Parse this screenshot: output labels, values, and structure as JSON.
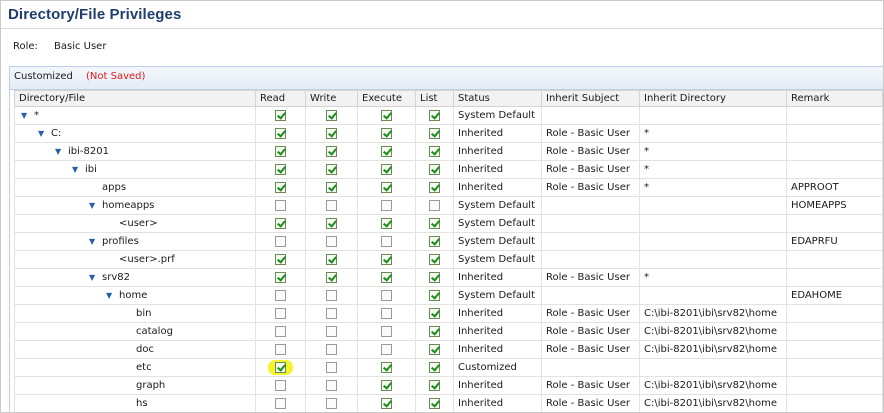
{
  "header": {
    "title": "Directory/File Privileges"
  },
  "role": {
    "label": "Role:",
    "value": "Basic User"
  },
  "panel": {
    "title": "Customized",
    "status": "(Not Saved)"
  },
  "table": {
    "columns": [
      "Directory/File",
      "Read",
      "Write",
      "Execute",
      "List",
      "Status",
      "Inherit Subject",
      "Inherit Directory",
      "Remark"
    ],
    "rows": [
      {
        "name": "*",
        "level": 0,
        "toggle": "expanded",
        "read": true,
        "write": true,
        "execute": true,
        "list": true,
        "status": "System Default",
        "subject": "",
        "directory": "",
        "remark": ""
      },
      {
        "name": "C:",
        "level": 1,
        "toggle": "expanded",
        "read": true,
        "write": true,
        "execute": true,
        "list": true,
        "status": "Inherited",
        "subject": "Role - Basic User",
        "directory": "*",
        "remark": ""
      },
      {
        "name": "ibi-8201",
        "level": 2,
        "toggle": "expanded",
        "read": true,
        "write": true,
        "execute": true,
        "list": true,
        "status": "Inherited",
        "subject": "Role - Basic User",
        "directory": "*",
        "remark": ""
      },
      {
        "name": "ibi",
        "level": 3,
        "toggle": "expanded",
        "read": true,
        "write": true,
        "execute": true,
        "list": true,
        "status": "Inherited",
        "subject": "Role - Basic User",
        "directory": "*",
        "remark": ""
      },
      {
        "name": "apps",
        "level": 4,
        "toggle": "none",
        "read": true,
        "write": true,
        "execute": true,
        "list": true,
        "status": "Inherited",
        "subject": "Role - Basic User",
        "directory": "*",
        "remark": "APPROOT"
      },
      {
        "name": "homeapps",
        "level": 4,
        "toggle": "expanded",
        "read": false,
        "write": false,
        "execute": false,
        "list": false,
        "status": "System Default",
        "subject": "",
        "directory": "",
        "remark": "HOMEAPPS"
      },
      {
        "name": "<user>",
        "level": 5,
        "toggle": "none",
        "read": true,
        "write": true,
        "execute": true,
        "list": true,
        "status": "System Default",
        "subject": "",
        "directory": "",
        "remark": ""
      },
      {
        "name": "profiles",
        "level": 4,
        "toggle": "expanded",
        "read": false,
        "write": false,
        "execute": false,
        "list": true,
        "status": "System Default",
        "subject": "",
        "directory": "",
        "remark": "EDAPRFU"
      },
      {
        "name": "<user>.prf",
        "level": 5,
        "toggle": "none",
        "read": true,
        "write": true,
        "execute": true,
        "list": true,
        "status": "System Default",
        "subject": "",
        "directory": "",
        "remark": ""
      },
      {
        "name": "srv82",
        "level": 4,
        "toggle": "expanded",
        "read": true,
        "write": true,
        "execute": true,
        "list": true,
        "status": "Inherited",
        "subject": "Role - Basic User",
        "directory": "*",
        "remark": ""
      },
      {
        "name": "home",
        "level": 5,
        "toggle": "expanded",
        "read": false,
        "write": false,
        "execute": false,
        "list": true,
        "status": "System Default",
        "subject": "",
        "directory": "",
        "remark": "EDAHOME"
      },
      {
        "name": "bin",
        "level": 6,
        "toggle": "none",
        "read": false,
        "write": false,
        "execute": false,
        "list": true,
        "status": "Inherited",
        "subject": "Role - Basic User",
        "directory": "C:\\ibi-8201\\ibi\\srv82\\home",
        "remark": ""
      },
      {
        "name": "catalog",
        "level": 6,
        "toggle": "none",
        "read": false,
        "write": false,
        "execute": false,
        "list": true,
        "status": "Inherited",
        "subject": "Role - Basic User",
        "directory": "C:\\ibi-8201\\ibi\\srv82\\home",
        "remark": ""
      },
      {
        "name": "doc",
        "level": 6,
        "toggle": "none",
        "read": false,
        "write": false,
        "execute": false,
        "list": true,
        "status": "Inherited",
        "subject": "Role - Basic User",
        "directory": "C:\\ibi-8201\\ibi\\srv82\\home",
        "remark": ""
      },
      {
        "name": "etc",
        "level": 6,
        "toggle": "none",
        "read": true,
        "write": false,
        "execute": true,
        "list": true,
        "status": "Customized",
        "subject": "",
        "directory": "",
        "remark": "",
        "highlight": "read"
      },
      {
        "name": "graph",
        "level": 6,
        "toggle": "none",
        "read": false,
        "write": false,
        "execute": true,
        "list": true,
        "status": "Inherited",
        "subject": "Role - Basic User",
        "directory": "C:\\ibi-8201\\ibi\\srv82\\home",
        "remark": ""
      },
      {
        "name": "hs",
        "level": 6,
        "toggle": "none",
        "read": false,
        "write": false,
        "execute": true,
        "list": true,
        "status": "Inherited",
        "subject": "Role - Basic User",
        "directory": "C:\\ibi-8201\\ibi\\srv82\\home",
        "remark": ""
      }
    ]
  }
}
